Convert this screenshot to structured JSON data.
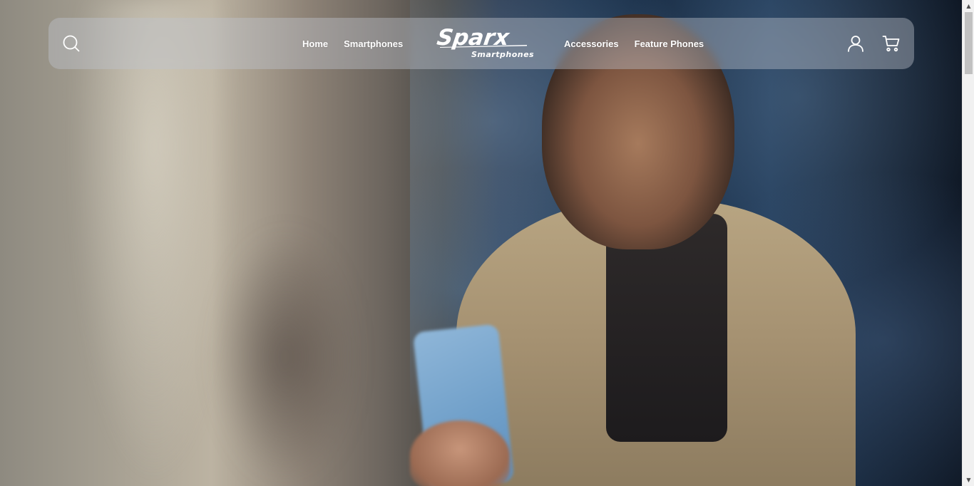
{
  "header": {
    "nav_left": [
      {
        "label": "Home"
      },
      {
        "label": "Smartphones"
      }
    ],
    "nav_right": [
      {
        "label": "Accessories"
      },
      {
        "label": "Feature Phones"
      }
    ],
    "logo": {
      "brand": "Sparx",
      "tagline": "Smartphones"
    },
    "icons": {
      "search": "search-icon",
      "account": "user-icon",
      "cart": "cart-icon"
    }
  },
  "hero": {
    "image": "hero-banner-image"
  },
  "scrollbar": {
    "up_arrow": "▲",
    "down_arrow": "▼"
  },
  "colors": {
    "header_bg": "rgba(190,195,205,0.42)",
    "nav_text": "#ffffff",
    "scrollbar_track": "#f1f1f1",
    "scrollbar_thumb": "#c1c1c1"
  }
}
